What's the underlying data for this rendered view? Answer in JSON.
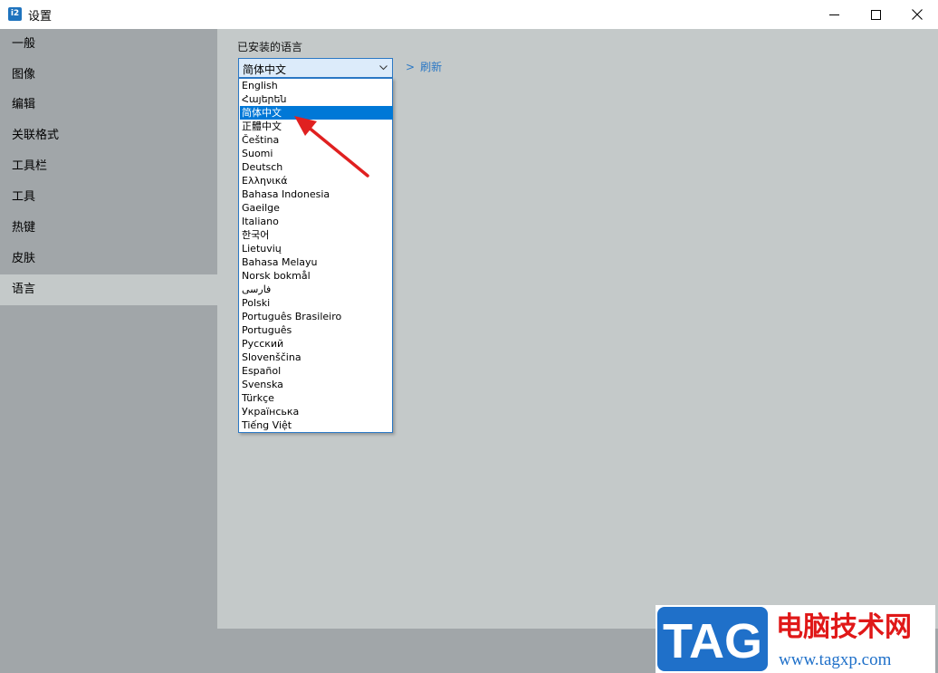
{
  "window": {
    "title": "设置",
    "app_icon_text": "i2"
  },
  "sidebar": {
    "items": [
      {
        "label": "一般"
      },
      {
        "label": "图像"
      },
      {
        "label": "编辑"
      },
      {
        "label": "关联格式"
      },
      {
        "label": "工具栏"
      },
      {
        "label": "工具"
      },
      {
        "label": "热键"
      },
      {
        "label": "皮肤"
      },
      {
        "label": "语言"
      }
    ],
    "selected_index": 8
  },
  "main": {
    "installed_languages_label": "已安装的语言",
    "language_select": {
      "value": "简体中文",
      "options": [
        "English",
        "Հայերեն",
        "简体中文",
        "正體中文",
        "Čeština",
        "Suomi",
        "Deutsch",
        "Ελληνικά",
        "Bahasa Indonesia",
        "Gaeilge",
        "Italiano",
        "한국어",
        "Lietuvių",
        "Bahasa Melayu",
        "Norsk bokmål",
        "فارسی",
        "Polski",
        "Português Brasileiro",
        "Português",
        "Русский",
        "Slovenščina",
        "Español",
        "Svenska",
        "Türkçe",
        "Українська",
        "Tiếng Việt"
      ],
      "selected_index": 2
    },
    "refresh_link": "刷新",
    "refresh_chevron": ">"
  },
  "watermark": {
    "tag_text": "TAG",
    "site_name": "电脑技术网",
    "url": "www.tagxp.com"
  },
  "colors": {
    "accent": "#0078d7",
    "annotation_arrow": "#e02020",
    "watermark_blue": "#1f70c9",
    "watermark_red": "#e01818"
  },
  "icons": {
    "minimize": "minimize-icon",
    "maximize": "maximize-icon",
    "close": "close-icon",
    "dropdown": "chevron-down-icon"
  }
}
